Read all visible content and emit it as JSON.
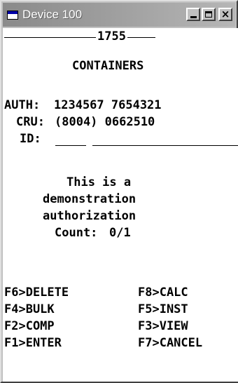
{
  "window": {
    "title": "Device 100"
  },
  "header": {
    "number": "1755",
    "title": "CONTAINERS"
  },
  "auth": {
    "label": "AUTH:",
    "value": "1234567 7654321"
  },
  "cru": {
    "label": "CRU:",
    "value": "(8004) 0662510"
  },
  "id": {
    "label": "ID:"
  },
  "message": {
    "line1": "This is a",
    "line2": "demonstration",
    "line3": "authorization",
    "count_label": "Count:",
    "count_value": "0/1"
  },
  "function_keys": {
    "f6": "F6>DELETE",
    "f8": "F8>CALC",
    "f4": "F4>BULK",
    "f5": "F5>INST",
    "f2": "F2>COMP",
    "f3": "F3>VIEW",
    "f1": "F1>ENTER",
    "f7": "F7>CANCEL"
  },
  "icons": {
    "app": "window-app-icon",
    "minimize": "minimize-icon",
    "maximize": "maximize-icon",
    "close": "close-icon"
  }
}
